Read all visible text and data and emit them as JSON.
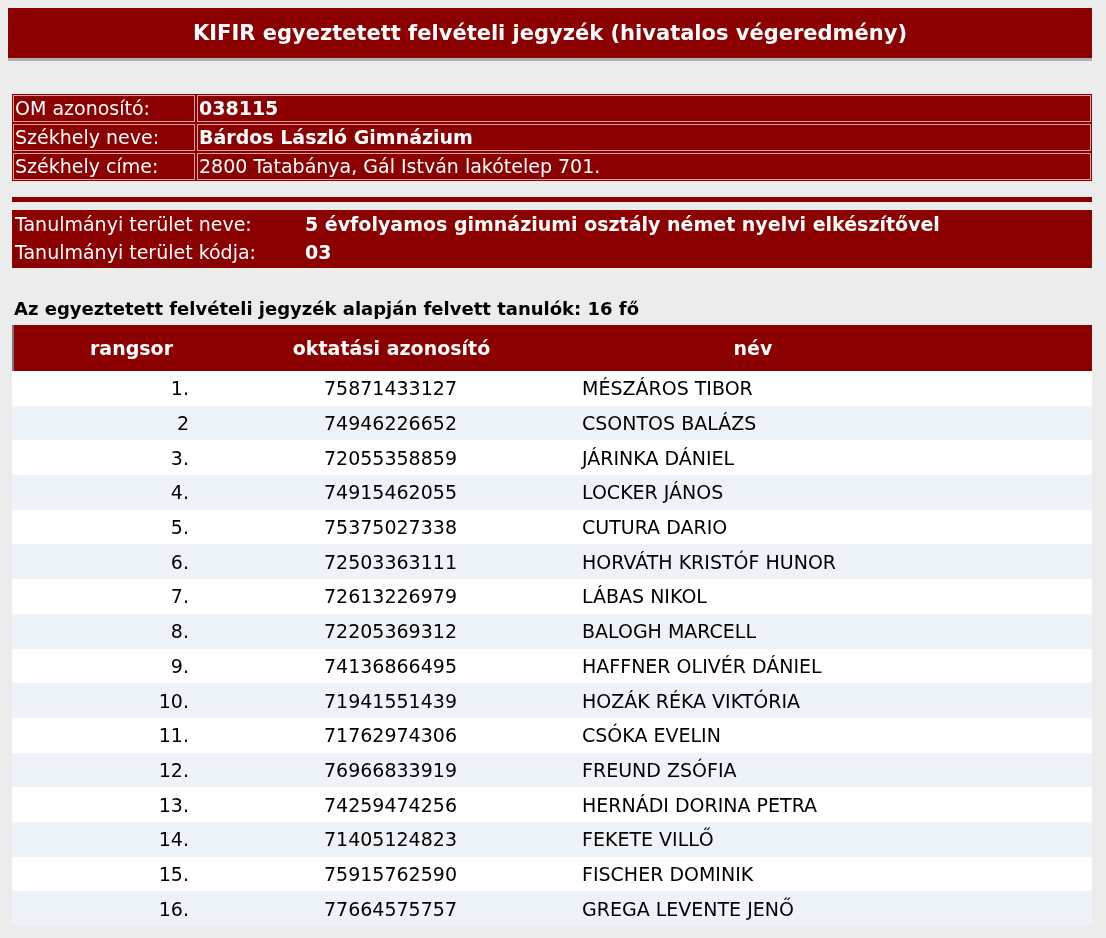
{
  "title": "KIFIR egyeztetett felvételi jegyzék (hivatalos végeredmény)",
  "school_info": [
    {
      "label": "OM azonosító:",
      "value": "038115",
      "bold": true
    },
    {
      "label": "Székhely neve:",
      "value": "Bárdos László Gimnázium",
      "bold": true
    },
    {
      "label": "Székhely címe:",
      "value": "2800 Tatabánya, Gál István lakótelep 701.",
      "bold": false
    }
  ],
  "program_info": [
    {
      "label": "Tanulmányi terület neve:",
      "value": "5 évfolyamos gimnáziumi osztály német nyelvi elkészítővel"
    },
    {
      "label": "Tanulmányi terület kódja:",
      "value": "03"
    }
  ],
  "summary": "Az egyeztetett felvételi jegyzék alapján felvett tanulók: 16 fő",
  "table": {
    "columns": [
      "rangsor",
      "oktatási azonosító",
      "név"
    ],
    "rows": [
      [
        "1.",
        "75871433127",
        "MÉSZÁROS TIBOR"
      ],
      [
        "2",
        "74946226652",
        "CSONTOS BALÁZS"
      ],
      [
        "3.",
        "72055358859",
        "JÁRINKA DÁNIEL"
      ],
      [
        "4.",
        "74915462055",
        "LOCKER JÁNOS"
      ],
      [
        "5.",
        "75375027338",
        "CUTURA DARIO"
      ],
      [
        "6.",
        "72503363111",
        "HORVÁTH KRISTÓF HUNOR"
      ],
      [
        "7.",
        "72613226979",
        "LÁBAS NIKOL"
      ],
      [
        "8.",
        "72205369312",
        "BALOGH MARCELL"
      ],
      [
        "9.",
        "74136866495",
        "HAFFNER OLIVÉR DÁNIEL"
      ],
      [
        "10.",
        "71941551439",
        "HOZÁK RÉKA VIKTÓRIA"
      ],
      [
        "11.",
        "71762974306",
        "CSÓKA EVELIN"
      ],
      [
        "12.",
        "76966833919",
        "FREUND ZSÓFIA"
      ],
      [
        "13.",
        "74259474256",
        "HERNÁDI DORINA PETRA"
      ],
      [
        "14.",
        "71405124823",
        "FEKETE VILLŐ"
      ],
      [
        "15.",
        "75915762590",
        "FISCHER DOMINIK"
      ],
      [
        "16.",
        "77664575757",
        "GREGA LEVENTE JENŐ"
      ]
    ]
  }
}
